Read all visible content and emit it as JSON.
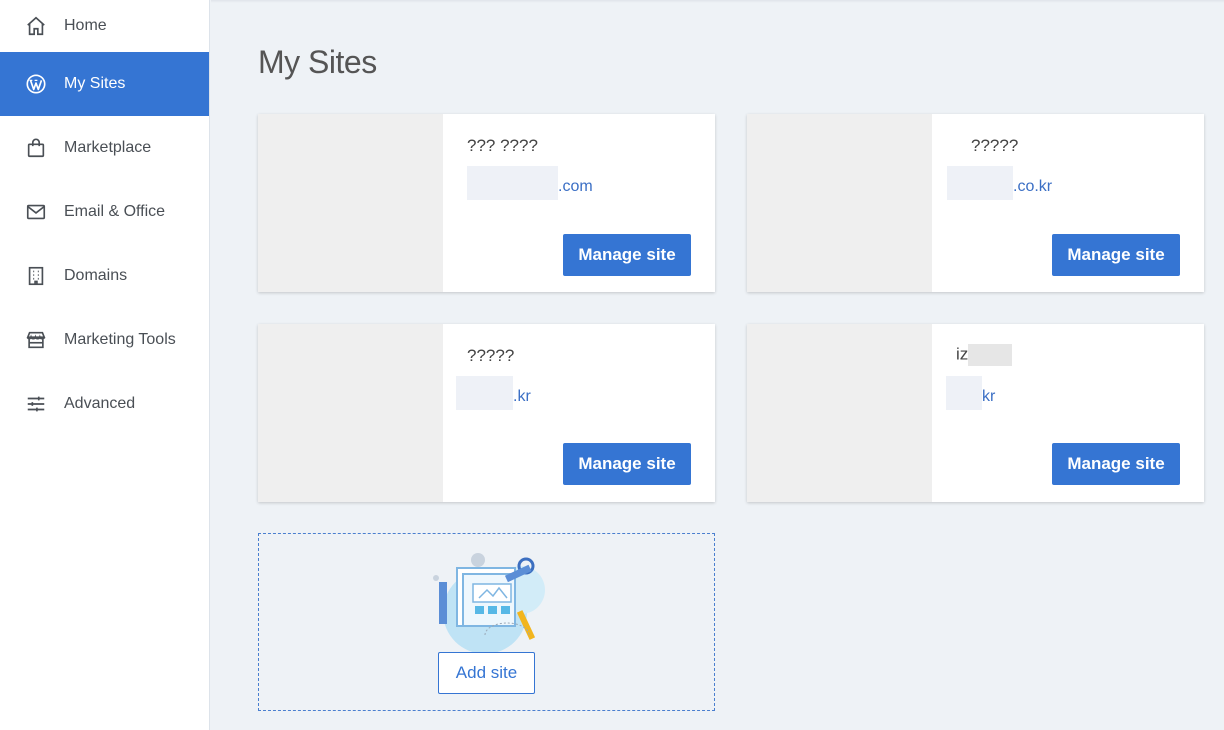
{
  "sidebar": {
    "items": [
      {
        "label": "Home",
        "icon": "home-icon"
      },
      {
        "label": "My Sites",
        "icon": "wordpress-icon",
        "active": true
      },
      {
        "label": "Marketplace",
        "icon": "shopping-bag-icon"
      },
      {
        "label": "Email & Office",
        "icon": "envelope-icon"
      },
      {
        "label": "Domains",
        "icon": "building-icon"
      },
      {
        "label": "Marketing Tools",
        "icon": "storefront-icon"
      },
      {
        "label": "Advanced",
        "icon": "sliders-icon"
      }
    ]
  },
  "main": {
    "title": "My Sites",
    "sites": [
      {
        "name": "??? ????",
        "url_suffix": ".com",
        "manage_label": "Manage site"
      },
      {
        "name": "?????",
        "url_suffix": ".co.kr",
        "manage_label": "Manage site"
      },
      {
        "name": "?????",
        "url_suffix": ".kr",
        "manage_label": "Manage site"
      },
      {
        "name": "iz",
        "url_suffix": "kr",
        "manage_label": "Manage site"
      }
    ],
    "add_site_label": "Add site"
  },
  "colors": {
    "accent": "#3575d3",
    "link": "#3b6fc5",
    "background": "#eef2f6"
  }
}
